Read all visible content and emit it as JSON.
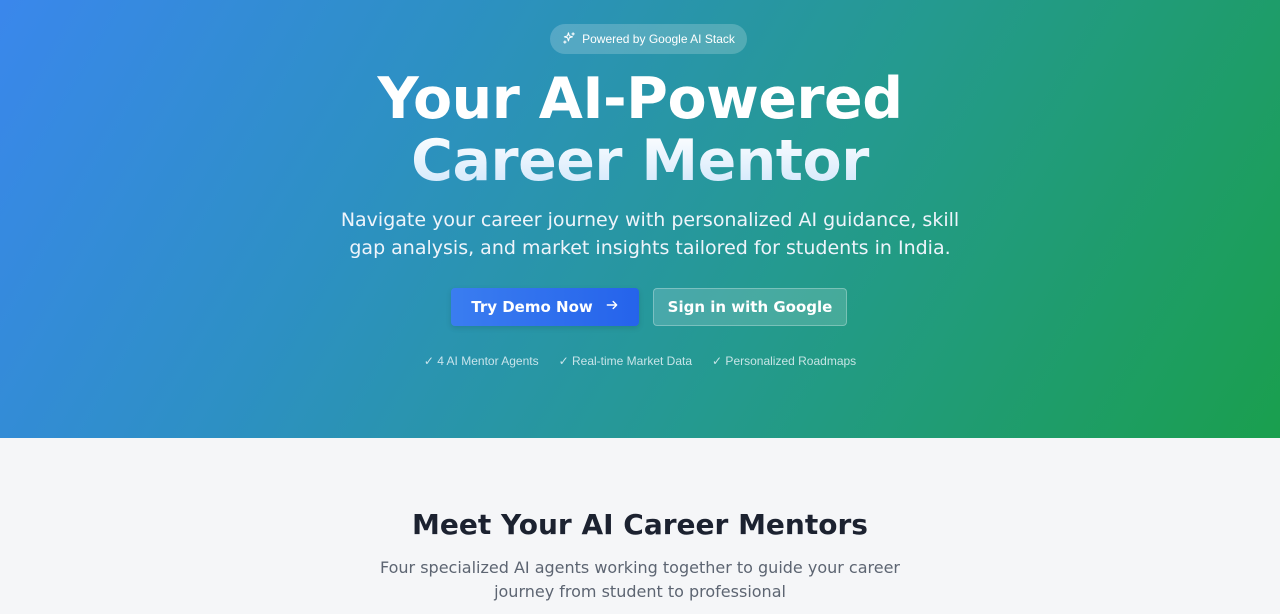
{
  "hero": {
    "badge": "Powered by Google AI Stack",
    "title_line1": "Your AI-Powered",
    "title_line2": "Career Mentor",
    "subtitle": "Navigate your career journey with personalized AI guidance, skill gap analysis, and market insights tailored for students in India.",
    "cta_primary": "Try Demo Now",
    "cta_secondary": "Sign in with Google",
    "features": [
      "✓ 4 AI Mentor Agents",
      "✓ Real-time Market Data",
      "✓ Personalized Roadmaps"
    ]
  },
  "mentors_section": {
    "title": "Meet Your AI Career Mentors",
    "subtitle": "Four specialized AI agents working together to guide your career journey from student to professional"
  },
  "colors": {
    "gradient_start": "#3a87ec",
    "gradient_end": "#1a9f4e",
    "primary_button": "#2563eb",
    "section_bg": "#f5f6f8",
    "heading": "#1c2230"
  },
  "icons": {
    "badge_icon": "sparkles-icon",
    "cta_icon": "arrow-right-icon"
  }
}
